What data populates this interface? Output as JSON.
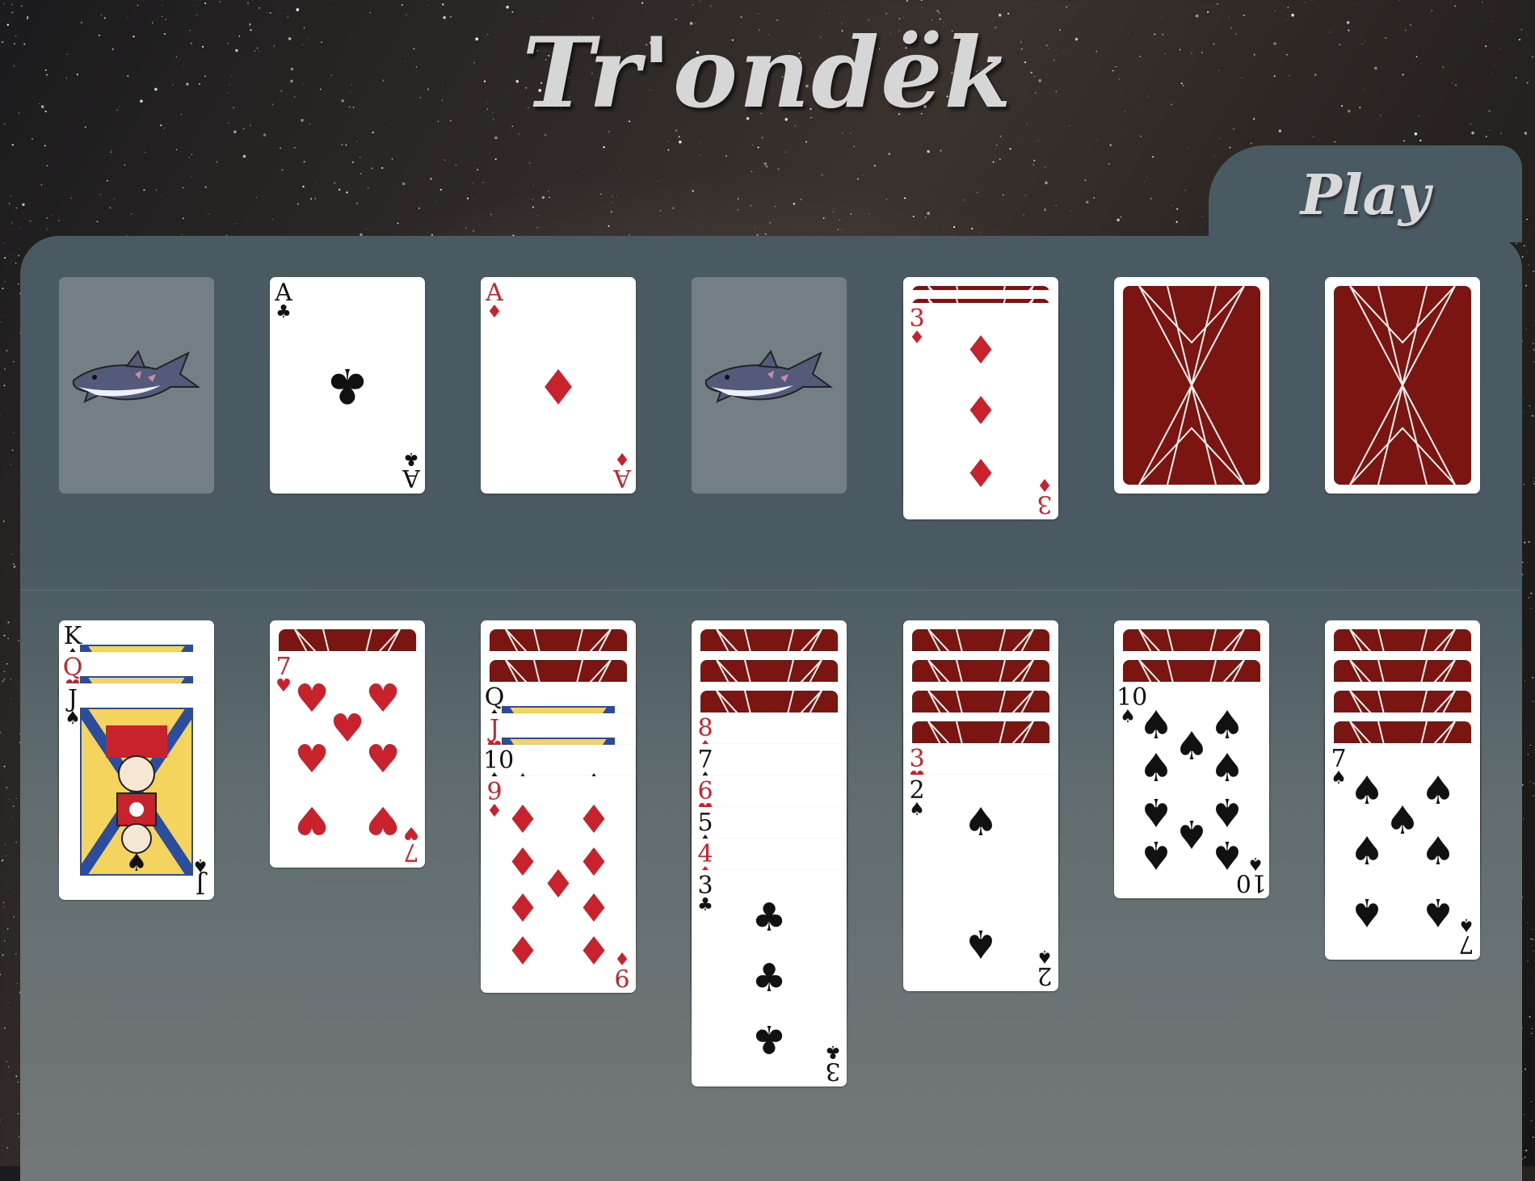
{
  "title": "Tr'ondëk",
  "play_tab": {
    "label": "Play"
  },
  "colors": {
    "table": "#4a5a63",
    "card_back": "#7a1511",
    "red_suit": "#c8222c",
    "black_suit": "#111111",
    "empty_slot": "#737f84"
  },
  "top_row": [
    {
      "kind": "empty-slot",
      "icon": "shark-icon"
    },
    {
      "kind": "face-up",
      "rank": "A",
      "suit": "♣",
      "color": "black"
    },
    {
      "kind": "face-up",
      "rank": "A",
      "suit": "♦",
      "color": "red"
    },
    {
      "kind": "empty-slot",
      "icon": "shark-icon"
    },
    {
      "kind": "waste",
      "hidden_above": 2,
      "top": {
        "rank": "3",
        "suit": "♦",
        "color": "red"
      }
    },
    {
      "kind": "face-down"
    },
    {
      "kind": "face-down"
    }
  ],
  "tableau": [
    {
      "hidden": 0,
      "cards": [
        {
          "rank": "K",
          "suit": "♠",
          "color": "black"
        },
        {
          "rank": "Q",
          "suit": "♥",
          "color": "red"
        },
        {
          "rank": "J",
          "suit": "♠",
          "color": "black"
        }
      ]
    },
    {
      "hidden": 1,
      "cards": [
        {
          "rank": "7",
          "suit": "♥",
          "color": "red"
        }
      ]
    },
    {
      "hidden": 2,
      "cards": [
        {
          "rank": "Q",
          "suit": "♠",
          "color": "black"
        },
        {
          "rank": "J",
          "suit": "♥",
          "color": "red"
        },
        {
          "rank": "10",
          "suit": "♠",
          "color": "black"
        },
        {
          "rank": "9",
          "suit": "♦",
          "color": "red"
        }
      ]
    },
    {
      "hidden": 3,
      "cards": [
        {
          "rank": "8",
          "suit": "♦",
          "color": "red"
        },
        {
          "rank": "7",
          "suit": "♠",
          "color": "black"
        },
        {
          "rank": "6",
          "suit": "♥",
          "color": "red"
        },
        {
          "rank": "5",
          "suit": "♠",
          "color": "black"
        },
        {
          "rank": "4",
          "suit": "♦",
          "color": "red"
        },
        {
          "rank": "3",
          "suit": "♣",
          "color": "black"
        }
      ]
    },
    {
      "hidden": 4,
      "cards": [
        {
          "rank": "3",
          "suit": "♥",
          "color": "red"
        },
        {
          "rank": "2",
          "suit": "♠",
          "color": "black"
        }
      ]
    },
    {
      "hidden": 2,
      "cards": [
        {
          "rank": "10",
          "suit": "♠",
          "color": "black"
        }
      ]
    },
    {
      "hidden": 4,
      "cards": [
        {
          "rank": "7",
          "suit": "♠",
          "color": "black"
        }
      ]
    }
  ]
}
